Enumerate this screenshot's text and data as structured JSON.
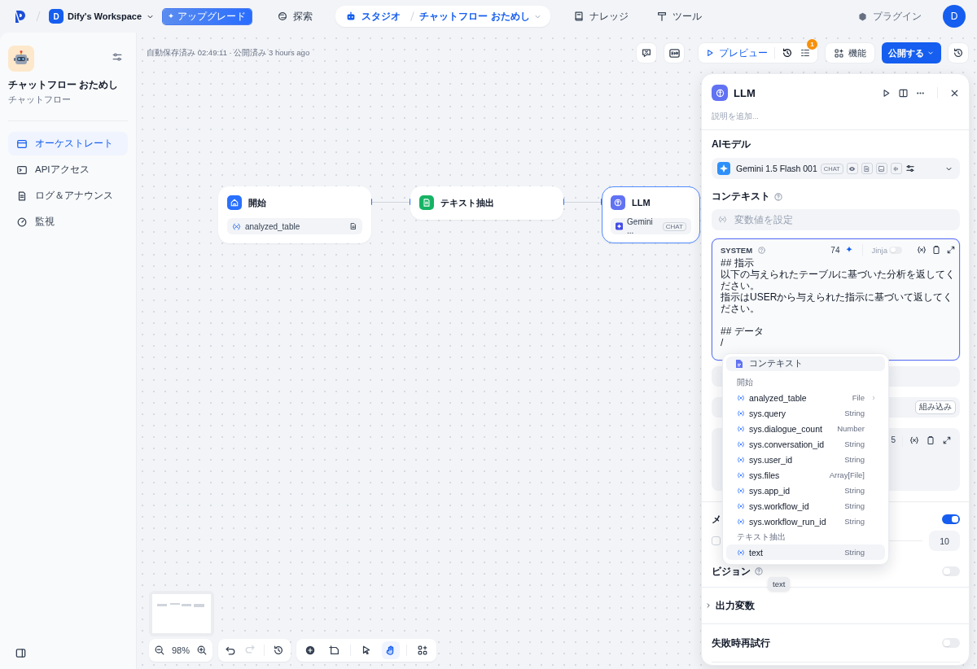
{
  "topbar": {
    "workspace_initial": "D",
    "workspace": "Dify's Workspace",
    "upgrade": "アップグレード",
    "nav": [
      {
        "kind": "explore",
        "label": "探索",
        "selected": false
      },
      {
        "kind": "studio",
        "label": "スタジオ",
        "selected": true,
        "app": "チャットフロー おためし"
      },
      {
        "kind": "knowledge",
        "label": "ナレッジ",
        "selected": false
      },
      {
        "kind": "tools",
        "label": "ツール",
        "selected": false
      }
    ],
    "plugins": "プラグイン",
    "avatar": "D"
  },
  "sidebar": {
    "app_name": "チャットフロー おためし",
    "app_type": "チャットフロー",
    "items": [
      {
        "kind": "orchestrate",
        "label": "オーケストレート",
        "selected": true
      },
      {
        "kind": "api",
        "label": "APIアクセス",
        "selected": false
      },
      {
        "kind": "logs",
        "label": "ログ＆アナウンス",
        "selected": false
      },
      {
        "kind": "monitor",
        "label": "監視",
        "selected": false
      }
    ]
  },
  "canvas": {
    "status": "自動保存済み 02:49:11 · 公開済み 3 hours ago",
    "preview": "プレビュー",
    "checklist_count": "1",
    "features": "機能",
    "publish": "公開する",
    "nodes": [
      {
        "kind": "start",
        "title": "開始",
        "selected": false,
        "variable": "analyzed_table"
      },
      {
        "kind": "extract",
        "title": "テキスト抽出",
        "selected": false
      },
      {
        "kind": "llm",
        "title": "LLM",
        "selected": true,
        "model": "Gemini ...",
        "tag": "CHAT"
      }
    ],
    "zoom": "98%",
    "tools": [
      {
        "kind": "pointer",
        "selected": false
      },
      {
        "kind": "hand",
        "selected": true
      }
    ]
  },
  "panel": {
    "title": "LLM",
    "description_placeholder": "説明を追加...",
    "model_label": "AIモデル",
    "model": "Gemini 1.5 Flash 001",
    "model_tag": "CHAT",
    "context_label": "コンテキスト",
    "context_placeholder": "変数値を設定",
    "system": {
      "role": "SYSTEM",
      "count": "74",
      "jinja": "Jinja",
      "jinja_on": false,
      "paragraphs": [
        {
          "lines": [
            "## 指示",
            "以下の与えられたテーブルに基づいた分析を返してください。",
            "指示はUSERから与えられた指示に基づいて返してください。"
          ]
        },
        {
          "lines": [
            "## データ",
            "/"
          ]
        }
      ]
    },
    "history_tag": "組み込み",
    "user_count": "5",
    "memory_label": "メ",
    "memory_on": true,
    "window_enabled": false,
    "window_size": "10",
    "vision_label": "ビジョン",
    "vision_on": false,
    "output_label": "出力変数",
    "output_expanded": false,
    "retry_label": "失敗時再試行",
    "retry_on": false
  },
  "variable_menu": {
    "context": {
      "label": "コンテキスト",
      "selected": true
    },
    "groups": [
      {
        "title": "開始",
        "vars": [
          {
            "name": "analyzed_table",
            "type": "File",
            "expandable": true,
            "selected": false
          },
          {
            "name": "sys.query",
            "type": "String",
            "expandable": false,
            "selected": false
          },
          {
            "name": "sys.dialogue_count",
            "type": "Number",
            "expandable": false,
            "selected": false
          },
          {
            "name": "sys.conversation_id",
            "type": "String",
            "expandable": false,
            "selected": false
          },
          {
            "name": "sys.user_id",
            "type": "String",
            "expandable": false,
            "selected": false
          },
          {
            "name": "sys.files",
            "type": "Array[File]",
            "expandable": false,
            "selected": false
          },
          {
            "name": "sys.app_id",
            "type": "String",
            "expandable": false,
            "selected": false
          },
          {
            "name": "sys.workflow_id",
            "type": "String",
            "expandable": false,
            "selected": false
          },
          {
            "name": "sys.workflow_run_id",
            "type": "String",
            "expandable": false,
            "selected": false
          }
        ]
      },
      {
        "title": "テキスト抽出",
        "vars": [
          {
            "name": "text",
            "type": "String",
            "expandable": false,
            "selected": true
          }
        ]
      }
    ],
    "tooltip": "text"
  }
}
